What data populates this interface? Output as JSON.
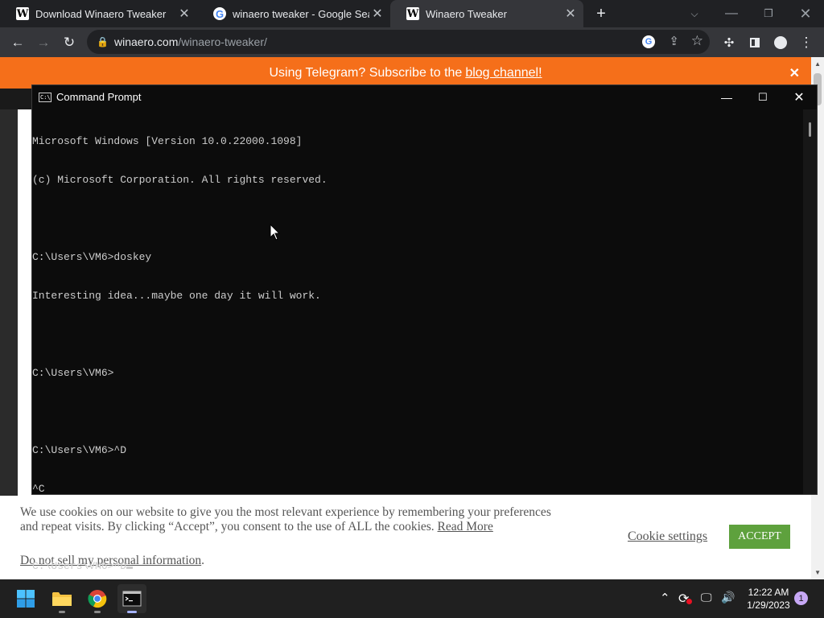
{
  "browser": {
    "tabs": [
      {
        "title": "Download Winaero Tweaker",
        "favicon": "winaero-w-icon",
        "active": false
      },
      {
        "title": "winaero tweaker - Google Search",
        "favicon": "google-g-icon",
        "active": false
      },
      {
        "title": "Winaero Tweaker",
        "favicon": "winaero-w-icon",
        "active": true
      }
    ],
    "new_tab_symbol": "+",
    "url_host": "winaero.com",
    "url_path": "/winaero-tweaker/"
  },
  "banner": {
    "text": "Using Telegram? Subscribe to the",
    "link": "blog channel!",
    "color": "#f56f1a"
  },
  "cookie": {
    "text": "We use cookies on our website to give you the most relevant experience by remembering your preferences and repeat visits. By clicking “Accept”, you consent to the use of ALL the cookies.",
    "read_more": "Read More",
    "do_not_sell": "Do not sell my personal information",
    "do_not_sell_suffix": ".",
    "settings_label": "Cookie settings",
    "accept_label": "ACCEPT",
    "accept_color": "#5ea13d"
  },
  "cmd": {
    "title": "Command Prompt",
    "lines": [
      "Microsoft Windows [Version 10.0.22000.1098]",
      "(c) Microsoft Corporation. All rights reserved.",
      "",
      "C:\\Users\\VM6>doskey",
      "Interesting idea...maybe one day it will work.",
      "",
      "C:\\Users\\VM6>",
      "",
      "C:\\Users\\VM6>^D",
      "^C",
      "",
      "C:\\Users\\VM6>^D"
    ]
  },
  "taskbar": {
    "apps": [
      "start-icon",
      "file-explorer-icon",
      "chrome-icon",
      "command-prompt-icon"
    ],
    "time": "12:22 AM",
    "date": "1/29/2023",
    "notification_count": "1"
  }
}
